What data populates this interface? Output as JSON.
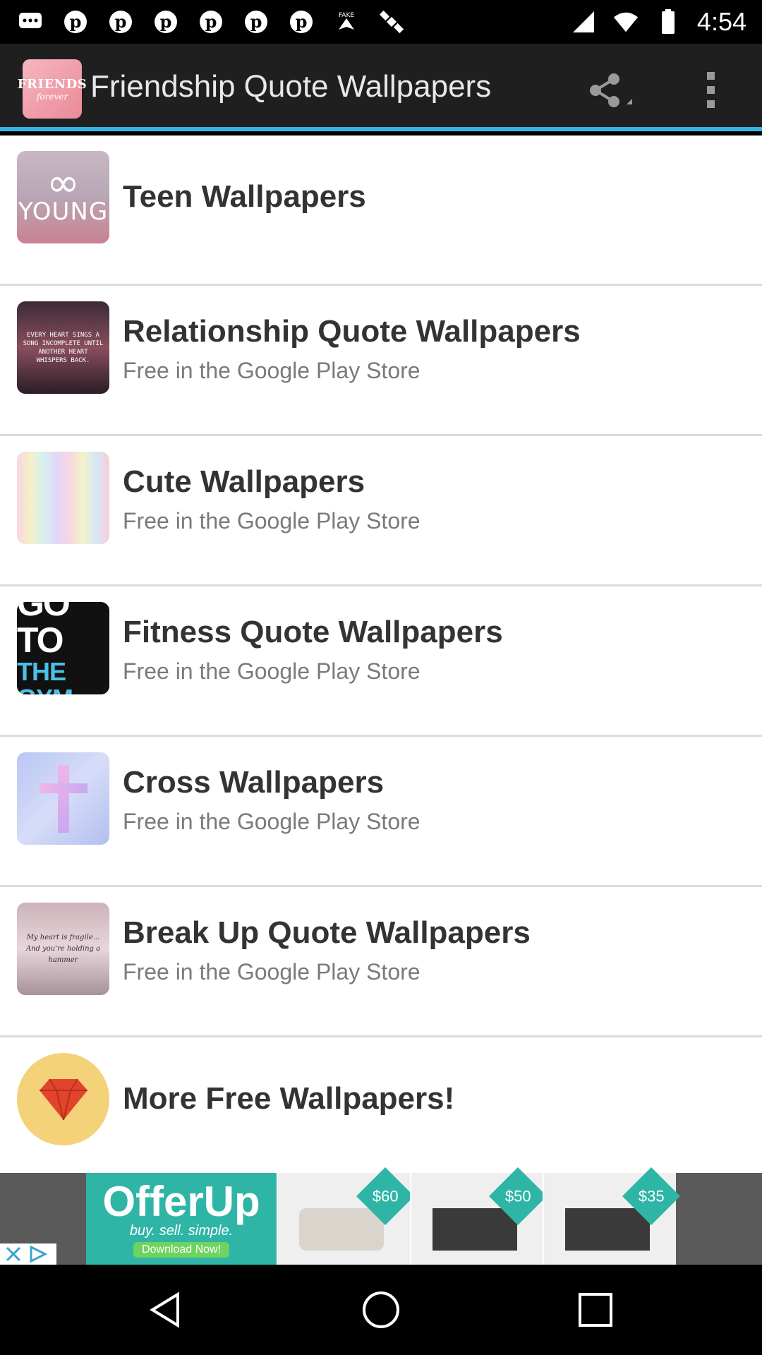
{
  "status_bar": {
    "time": "4:54",
    "icons": [
      "chat-bubble-icon",
      "pinterest-icon",
      "pinterest-icon",
      "pinterest-icon",
      "pinterest-icon",
      "pinterest-icon",
      "pinterest-icon",
      "fake-gps-icon",
      "satellite-icon",
      "signal-icon",
      "wifi-icon",
      "battery-icon"
    ]
  },
  "app_bar": {
    "logo_text": "FRIENDS",
    "logo_subtext": "forever",
    "title": "Friendship Quote Wallpapers",
    "share_icon": "share-icon",
    "menu_icon": "overflow-menu-icon"
  },
  "list": [
    {
      "title": "Teen Wallpapers",
      "subtitle": "",
      "thumb_text": "YOUNG"
    },
    {
      "title": "Relationship Quote Wallpapers",
      "subtitle": "Free in the Google Play Store",
      "thumb_text": "EVERY HEART SINGS A SONG INCOMPLETE UNTIL ANOTHER HEART WHISPERS BACK."
    },
    {
      "title": "Cute Wallpapers",
      "subtitle": "Free in the Google Play Store",
      "thumb_text": ""
    },
    {
      "title": "Fitness Quote Wallpapers",
      "subtitle": "Free in the Google Play Store",
      "thumb_text_1": "GO TO",
      "thumb_text_2": "THE GYM"
    },
    {
      "title": "Cross Wallpapers",
      "subtitle": "Free in the Google Play Store",
      "thumb_text": ""
    },
    {
      "title": "Break Up Quote Wallpapers",
      "subtitle": "Free in the Google Play Store",
      "thumb_text_1": "My heart is fragile...",
      "thumb_text_2": "And you're holding a hammer"
    },
    {
      "title": "More Free Wallpapers!",
      "subtitle": "",
      "thumb_text": ""
    }
  ],
  "ad": {
    "brand": "OfferUp",
    "tagline": "buy. sell. simple.",
    "cta": "Download Now!",
    "prices": [
      "$60",
      "$50",
      "$35"
    ]
  },
  "nav_bar": {
    "back_icon": "back-icon",
    "home_icon": "home-icon",
    "recents_icon": "recents-icon"
  },
  "colors": {
    "accent": "#33b5e5",
    "app_bar_bg": "#1f1f1f",
    "list_bg": "#ffffff",
    "title_text": "#333333",
    "subtitle_text": "#7a7a7a"
  }
}
